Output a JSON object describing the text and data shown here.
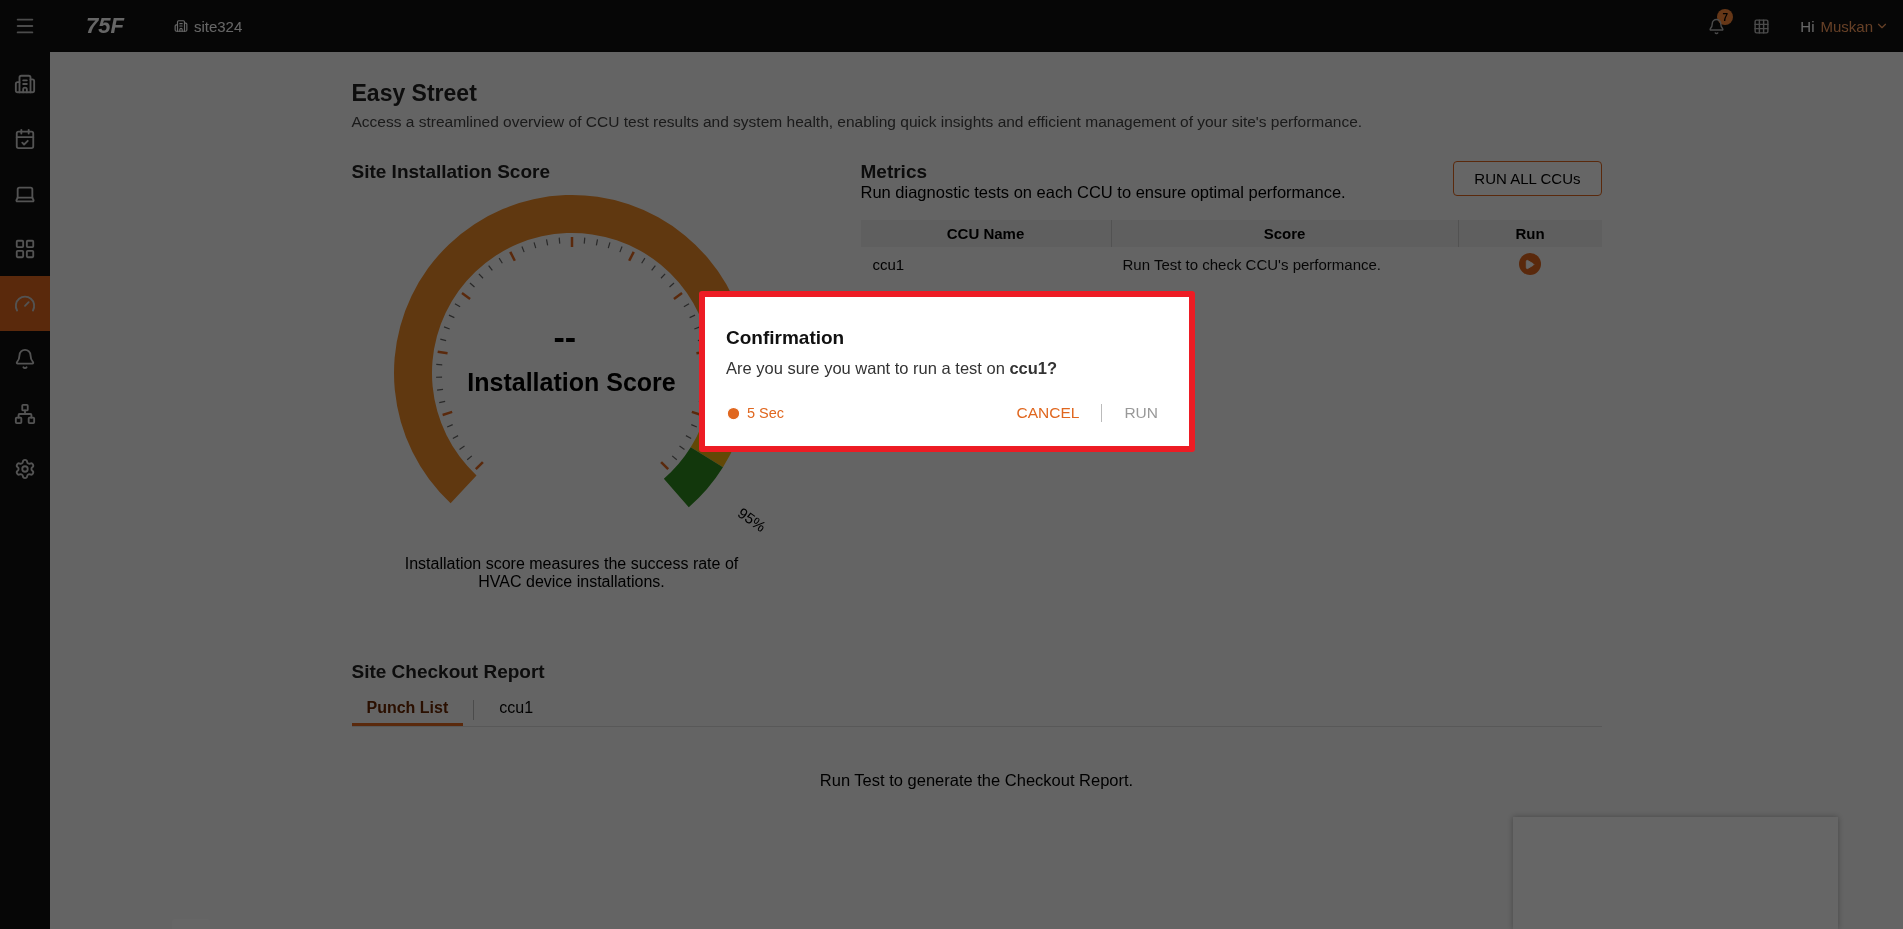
{
  "topbar": {
    "logo_text": "75F",
    "site": "site324",
    "notifications": "7",
    "greeting": "Hi",
    "user": "Muskan"
  },
  "sidebar": {
    "items": [
      {
        "selected": false
      },
      {
        "selected": false
      },
      {
        "selected": false
      },
      {
        "selected": false
      },
      {
        "selected": true
      },
      {
        "selected": false
      },
      {
        "selected": false
      },
      {
        "selected": false
      }
    ]
  },
  "page": {
    "title": "Easy Street",
    "description": "Access a streamlined overview of CCU test results and system health, enabling quick insights and efficient management of your site's performance."
  },
  "installation": {
    "title": "Site Installation Score",
    "score": "--",
    "score_label": "Installation Score",
    "threshold": "95%",
    "caption": "Installation score measures the success rate of HVAC device installations."
  },
  "metrics": {
    "title": "Metrics",
    "description": "Run diagnostic tests on each CCU to ensure optimal performance.",
    "button": "RUN ALL CCUs",
    "columns": [
      "CCU Name",
      "Score",
      "Run"
    ],
    "rows": [
      {
        "name": "ccu1",
        "score": "Run Test to check CCU's performance."
      }
    ]
  },
  "checkout": {
    "title": "Site Checkout Report",
    "tabs": [
      {
        "label": "Punch List",
        "selected": true
      },
      {
        "label": "ccu1",
        "selected": false
      }
    ],
    "empty_message": "Run Test to generate the Checkout Report."
  },
  "dialog": {
    "title": "Confirmation",
    "message": "Are you sure you want to run a test on **ccu1?**",
    "timer": "5 Sec",
    "actions": [
      {
        "label": "CANCEL",
        "disabled": false
      },
      {
        "label": "RUN",
        "disabled": true
      }
    ]
  }
}
